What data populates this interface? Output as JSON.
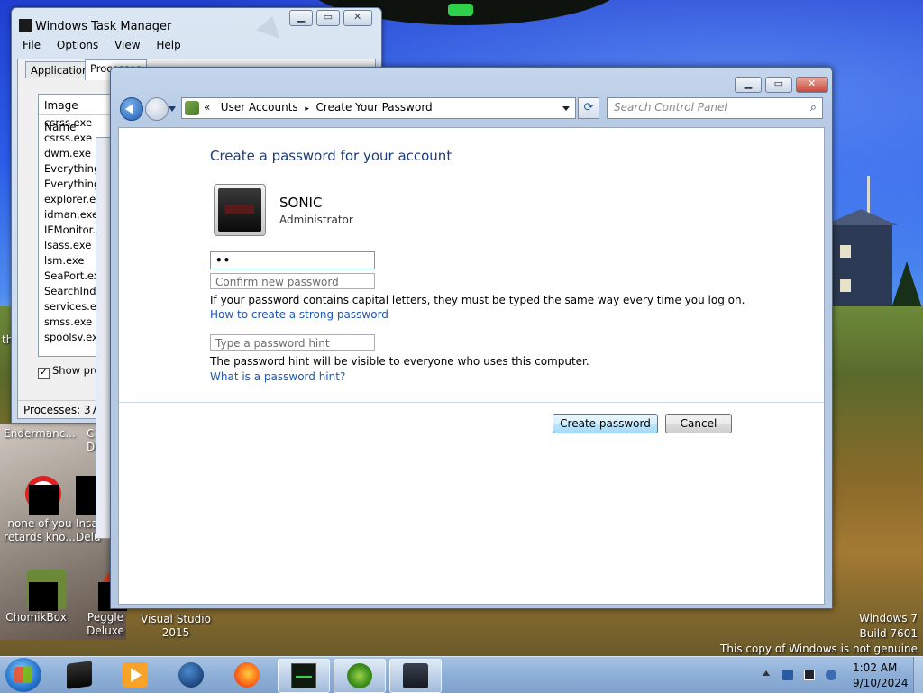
{
  "desktop": {
    "icons": [
      {
        "label": "Endermanc..."
      },
      {
        "label": "none of you retards kno..."
      },
      {
        "label": "ChomikBox"
      },
      {
        "label": "Peggle Deluxe"
      },
      {
        "label": "Visual Studio 2015"
      }
    ],
    "partial_labels": {
      "left_th": "th",
      "c_col": "C",
      "d_col": "D",
      "insa": "Insa",
      "delu": "Delu"
    },
    "watermark": {
      "line1": "Windows 7",
      "line2": "Build 7601",
      "line3": "This copy of Windows is not genuine"
    }
  },
  "task_manager": {
    "title": "Windows Task Manager",
    "menu": [
      "File",
      "Options",
      "View",
      "Help"
    ],
    "tabs": [
      "Applications",
      "Processes"
    ],
    "column_header": "Image Name",
    "processes": [
      "csrss.exe",
      "csrss.exe",
      "dwm.exe",
      "Everything.",
      "Everything.",
      "explorer.ex",
      "idman.exe *",
      "IEMonitor.e",
      "lsass.exe",
      "lsm.exe",
      "SeaPort.exe",
      "SearchIndex",
      "services.ex",
      "smss.exe",
      "spoolsv.exe"
    ],
    "show_processes_label": "Show proc",
    "status": "Processes: 37"
  },
  "control_panel": {
    "breadcrumb": [
      "User Accounts",
      "Create Your Password"
    ],
    "breadcrumb_prefix": "«",
    "breadcrumb_sep": "▸",
    "search_placeholder": "Search Control Panel",
    "heading": "Create a password for your account",
    "user": {
      "name": "SONIC",
      "role": "Administrator"
    },
    "new_password_value": "••",
    "confirm_placeholder": "Confirm new password",
    "caps_info": "If your password contains capital letters, they must be typed the same way every time you log on.",
    "strong_link": "How to create a strong password",
    "hint_placeholder": "Type a password hint",
    "hint_info": "The password hint will be visible to everyone who uses this computer.",
    "hint_link": "What is a password hint?",
    "create_button": "Create password",
    "cancel_button": "Cancel"
  },
  "taskbar": {
    "time": "1:02 AM",
    "date": "9/10/2024"
  }
}
